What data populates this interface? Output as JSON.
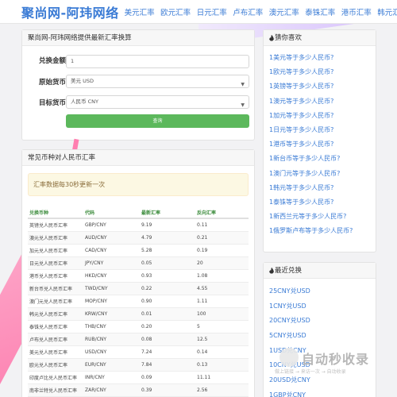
{
  "site": {
    "title": "聚尚网-阿玮网络",
    "nav": [
      "美元汇率",
      "欧元汇率",
      "日元汇率",
      "卢布汇率",
      "澳元汇率",
      "泰铢汇率",
      "港币汇率",
      "韩元汇率"
    ]
  },
  "converter": {
    "heading": "聚尚网-阿玮网络提供最新汇率换算",
    "amount_label": "兑换金额",
    "amount_value": "1",
    "source_label": "原始货币",
    "source_value": "美元 USD",
    "target_label": "目标货币",
    "target_value": "人民币 CNY",
    "submit_label": "查询"
  },
  "rates": {
    "heading": "常见币种对人民币汇率",
    "notice": "汇率数据每30秒更新一次",
    "columns": [
      "兑换币种",
      "代码",
      "最新汇率",
      "反向汇率"
    ],
    "rows": [
      [
        "英镑兑人民币汇率",
        "GBP/CNY",
        "9.19",
        "0.11"
      ],
      [
        "澳元兑人民币汇率",
        "AUD/CNY",
        "4.79",
        "0.21"
      ],
      [
        "加元兑人民币汇率",
        "CAD/CNY",
        "5.28",
        "0.19"
      ],
      [
        "日元兑人民币汇率",
        "JPY/CNY",
        "0.05",
        "20"
      ],
      [
        "港币兑人民币汇率",
        "HKD/CNY",
        "0.93",
        "1.08"
      ],
      [
        "新台币兑人民币汇率",
        "TWD/CNY",
        "0.22",
        "4.55"
      ],
      [
        "澳门元兑人民币汇率",
        "MOP/CNY",
        "0.90",
        "1.11"
      ],
      [
        "韩元兑人民币汇率",
        "KRW/CNY",
        "0.01",
        "100"
      ],
      [
        "泰铢兑人民币汇率",
        "THB/CNY",
        "0.20",
        "5"
      ],
      [
        "卢布兑人民币汇率",
        "RUB/CNY",
        "0.08",
        "12.5"
      ],
      [
        "美元兑人民币汇率",
        "USD/CNY",
        "7.24",
        "0.14"
      ],
      [
        "欧元兑人民币汇率",
        "EUR/CNY",
        "7.84",
        "0.13"
      ],
      [
        "印度卢比兑人民币汇率",
        "INR/CNY",
        "0.09",
        "11.11"
      ],
      [
        "南非兰特兑人民币汇率",
        "ZAR/CNY",
        "0.39",
        "2.56"
      ]
    ]
  },
  "guess": {
    "heading": "猜你喜欢",
    "items": [
      "1美元等于多少人民币?",
      "1欧元等于多少人民币?",
      "1英镑等于多少人民币?",
      "1澳元等于多少人民币?",
      "1加元等于多少人民币?",
      "1日元等于多少人民币?",
      "1港币等于多少人民币?",
      "1新台币等于多少人民币?",
      "1澳门元等于多少人民币?",
      "1韩元等于多少人民币?",
      "1泰铢等于多少人民币?",
      "1新西兰元等于多少人民币?",
      "1俄罗斯卢布等于多少人民币?"
    ]
  },
  "recent": {
    "heading": "最近兑换",
    "items": [
      "25CNY兑USD",
      "1CNY兑USD",
      "20CNY兑USD",
      "5CNY兑USD",
      "1USD兑CNY",
      "10CNY兑USD",
      "20USD兑CNY",
      "1GBP兑CNY"
    ]
  },
  "watermark": {
    "title": "自动秒收录",
    "subtitle": "做上链接 → 来访一次 → 自动收录"
  }
}
